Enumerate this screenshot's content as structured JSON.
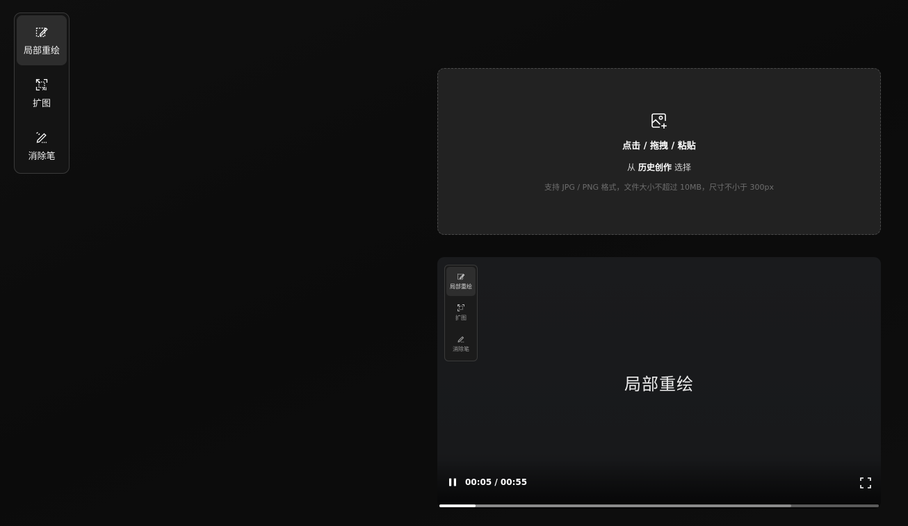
{
  "toolbar": {
    "items": [
      {
        "label": "局部重绘",
        "icon": "inpaint-icon",
        "active": true
      },
      {
        "label": "扩图",
        "icon": "expand-image-icon",
        "active": false
      },
      {
        "label": "消除笔",
        "icon": "eraser-pen-icon",
        "active": false
      }
    ]
  },
  "upload": {
    "icon": "image-add-icon",
    "main_text": "点击 / 拖拽 / 粘贴",
    "sub_prefix": "从",
    "sub_link": "历史创作",
    "sub_suffix": "选择",
    "hint": "支持 JPG / PNG 格式，文件大小不超过 10MB，尺寸不小于 300px"
  },
  "video": {
    "mini_toolbar": [
      {
        "label": "局部重绘",
        "active": true
      },
      {
        "label": "扩图",
        "active": false
      },
      {
        "label": "消除笔",
        "active": false
      }
    ],
    "title": "局部重绘",
    "time_display": "00:05 / 00:55",
    "progress_played": 0.082,
    "progress_buffered": 0.8,
    "state": "playing"
  },
  "colors": {
    "background": "#0d0d0d",
    "panel": "#222222",
    "accent": "#ffffff"
  }
}
